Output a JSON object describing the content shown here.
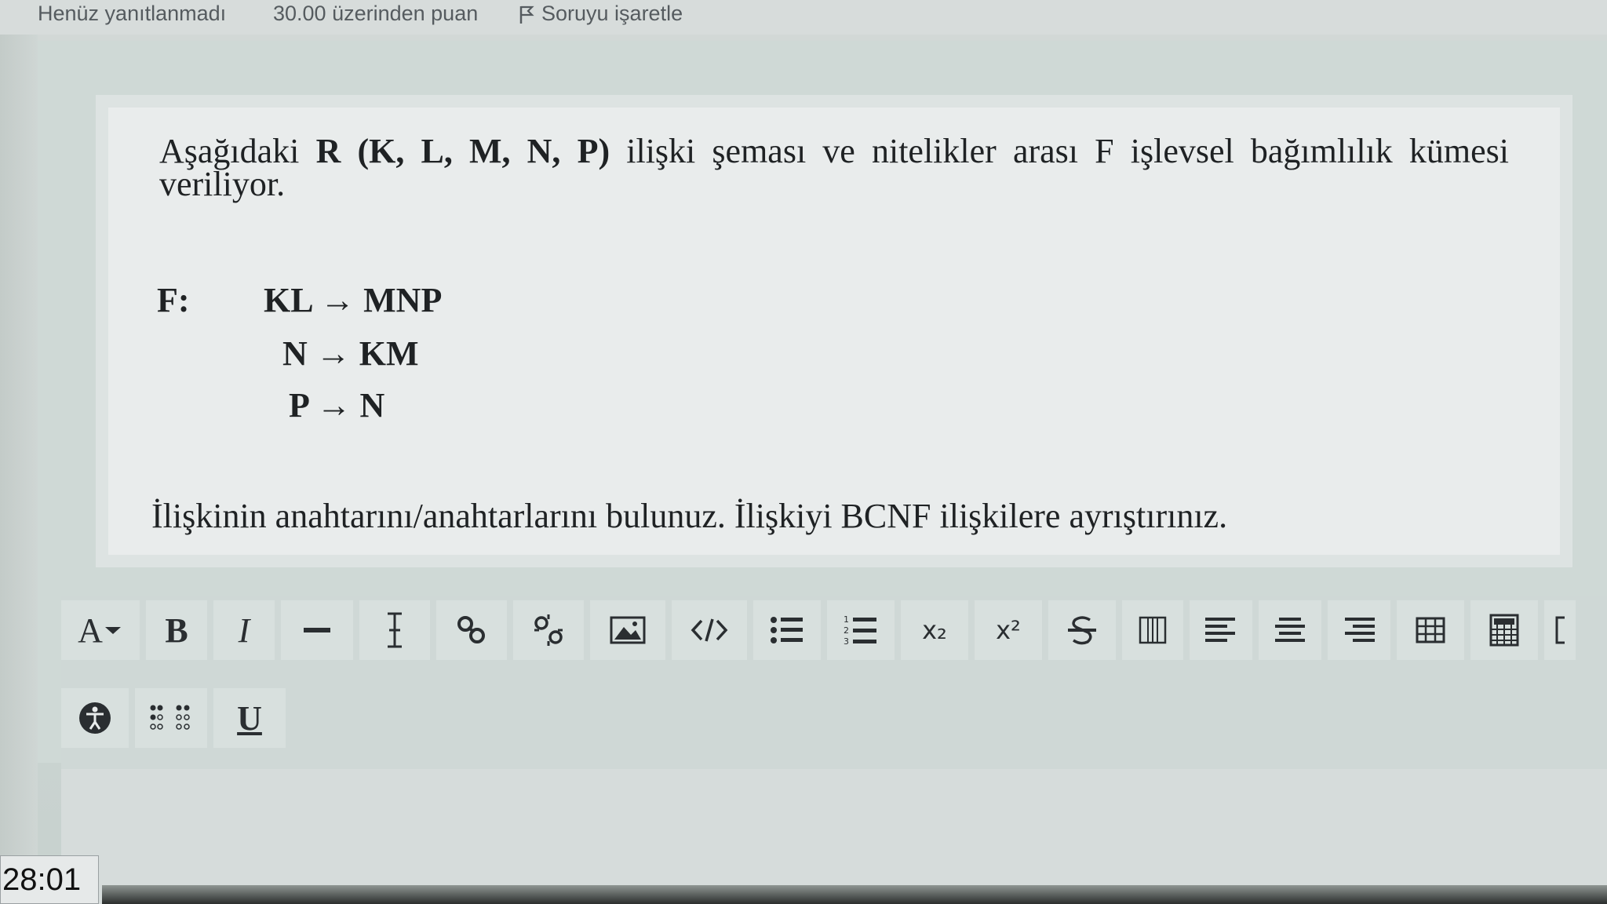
{
  "header": {
    "status": "Henüz yanıtlanmadı",
    "points": "30.00 üzerinden puan",
    "flag_label": "Soruyu işaretle"
  },
  "question": {
    "intro_prefix": "Aşağıdaki ",
    "intro_bold": "R (K, L, M, N, P)",
    "intro_suffix": " ilişki şeması ve nitelikler arası F işlevsel bağımlılık kümesi veriliyor.",
    "fd_label": "F:",
    "dependencies": [
      "KL → MNP",
      "N → KM",
      "P → N"
    ],
    "instruction": "İlişkinin anahtarını/anahtarlarını bulunuz. İlişkiyi BCNF ilişkilere ayrıştırınız."
  },
  "toolbar": {
    "font_label": "A",
    "bold_label": "B",
    "italic_label": "I",
    "subscript_label": "x₂",
    "superscript_label": "x²",
    "underline_label": "U"
  },
  "timer": "28:01"
}
